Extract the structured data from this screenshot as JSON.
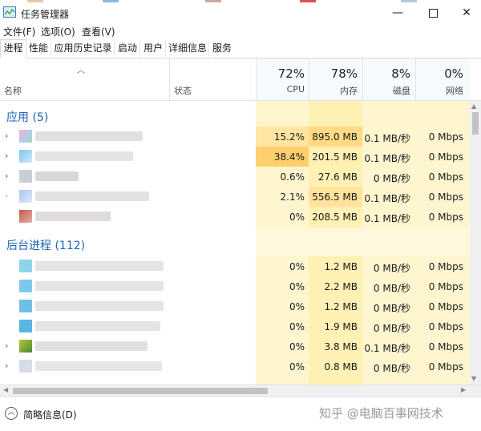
{
  "window": {
    "title": "任务管理器",
    "controls": {
      "minimize": "—",
      "maximize": "",
      "close": "✕"
    }
  },
  "menu": [
    "文件(F)",
    "选项(O)",
    "查看(V)"
  ],
  "tabs": [
    "进程",
    "性能",
    "应用历史记录",
    "启动",
    "用户",
    "详细信息",
    "服务"
  ],
  "active_tab": "进程",
  "columns": {
    "name": "名称",
    "status": "状态",
    "cpu": {
      "pct": "72%",
      "label": "CPU"
    },
    "memory": {
      "pct": "78%",
      "label": "内存"
    },
    "disk": {
      "pct": "8%",
      "label": "磁盘"
    },
    "network": {
      "pct": "0%",
      "label": "网络"
    }
  },
  "groups": {
    "apps": {
      "title": "应用 (5)",
      "rows": [
        {
          "cpu": "15.2%",
          "mem": "895.0 MB",
          "disk": "0.1 MB/秒",
          "net": "0 Mbps"
        },
        {
          "cpu": "38.4%",
          "mem": "201.5 MB",
          "disk": "0.1 MB/秒",
          "net": "0 Mbps"
        },
        {
          "cpu": "0.6%",
          "mem": "27.6 MB",
          "disk": "0 MB/秒",
          "net": "0 Mbps"
        },
        {
          "cpu": "2.1%",
          "mem": "556.5 MB",
          "disk": "0.1 MB/秒",
          "net": "0 Mbps"
        },
        {
          "cpu": "0%",
          "mem": "208.5 MB",
          "disk": "0.1 MB/秒",
          "net": "0 Mbps"
        }
      ]
    },
    "background": {
      "title": "后台进程 (112)",
      "rows": [
        {
          "cpu": "0%",
          "mem": "1.2 MB",
          "disk": "0 MB/秒",
          "net": "0 Mbps"
        },
        {
          "cpu": "0%",
          "mem": "2.2 MB",
          "disk": "0 MB/秒",
          "net": "0 Mbps"
        },
        {
          "cpu": "0%",
          "mem": "1.2 MB",
          "disk": "0 MB/秒",
          "net": "0 Mbps"
        },
        {
          "cpu": "0%",
          "mem": "1.9 MB",
          "disk": "0 MB/秒",
          "net": "0 Mbps"
        },
        {
          "cpu": "0%",
          "mem": "3.8 MB",
          "disk": "0.1 MB/秒",
          "net": "0 Mbps"
        },
        {
          "cpu": "0%",
          "mem": "0.8 MB",
          "disk": "0 MB/秒",
          "net": "0 Mbps"
        }
      ]
    }
  },
  "footer": {
    "fewer_details": "简略信息(D)",
    "watermark": "知乎 @电脑百事网技术"
  },
  "colors": {
    "group_title": "#1e64b4",
    "heat_light": "#fff4c4",
    "heat_medium": "#ffe8a8",
    "heat_strong": "#ffd57a",
    "mem_column": "#fff0b4"
  }
}
